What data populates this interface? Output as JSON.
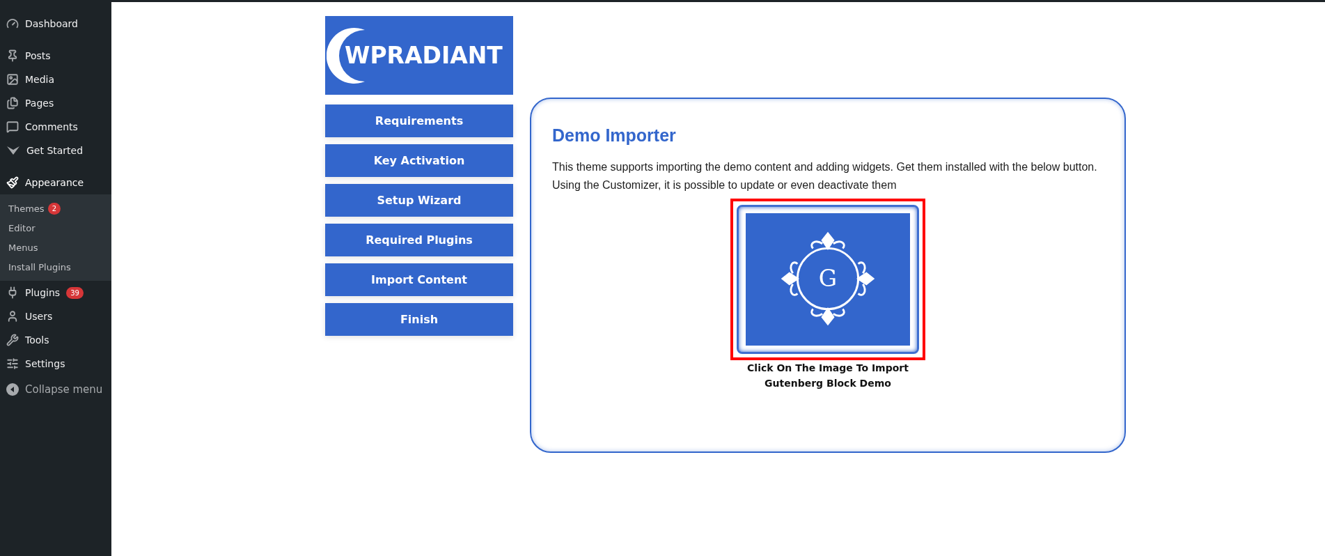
{
  "sidebar": {
    "sections": [
      [
        {
          "label": "Dashboard",
          "current": false
        }
      ],
      [
        {
          "label": "Posts",
          "current": false
        },
        {
          "label": "Media",
          "current": false
        },
        {
          "label": "Pages",
          "current": false
        },
        {
          "label": "Comments",
          "current": false
        },
        {
          "label": "Get Started",
          "current": false
        }
      ],
      [
        {
          "label": "Appearance",
          "current": true,
          "children": [
            {
              "label": "Themes",
              "badge": "2"
            },
            {
              "label": "Editor"
            },
            {
              "label": "Menus"
            },
            {
              "label": "Install Plugins"
            }
          ]
        },
        {
          "label": "Plugins",
          "current": false,
          "badge": "39"
        },
        {
          "label": "Users",
          "current": false
        },
        {
          "label": "Tools",
          "current": false
        },
        {
          "label": "Settings",
          "current": false
        }
      ]
    ],
    "collapse": "Collapse menu"
  },
  "logo": {
    "text": "WPRADIANT"
  },
  "steps": [
    "Requirements",
    "Key Activation",
    "Setup Wizard",
    "Required Plugins",
    "Import Content",
    "Finish"
  ],
  "panel": {
    "title": "Demo Importer",
    "description": "This theme supports importing the demo content and adding widgets. Get them installed with the below button. Using the Customizer, it is possible to update or even deactivate them",
    "demo": {
      "monogram": "G",
      "caption_lines": [
        "Click On The Image To Import",
        "Gutenberg Block Demo"
      ]
    }
  }
}
